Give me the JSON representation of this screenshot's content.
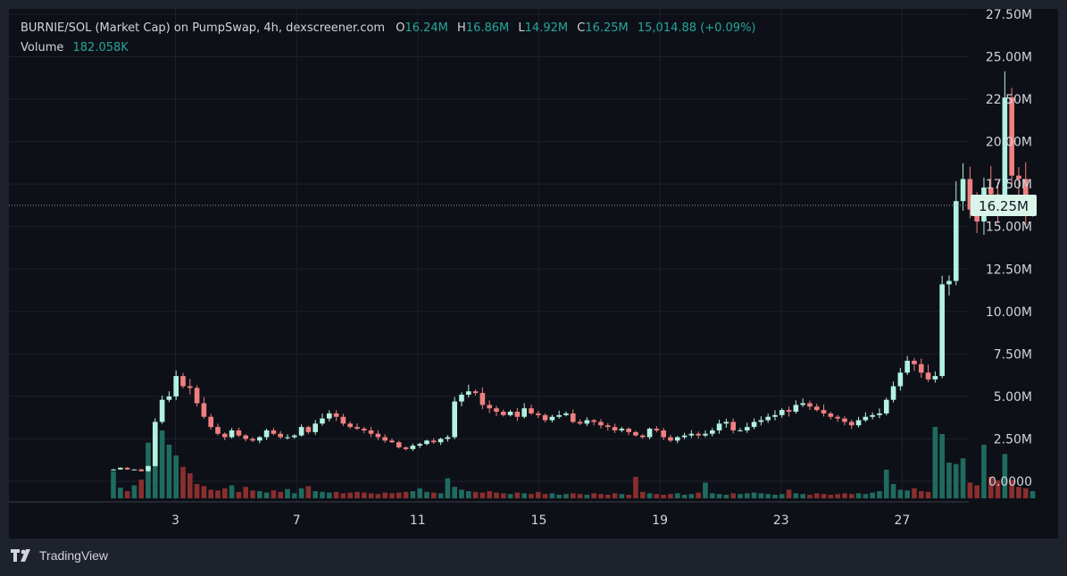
{
  "colors": {
    "bg": "#0e1017",
    "outer": "#1e222d",
    "grid": "#1c202b",
    "text": "#d1d4dc",
    "up": "#26a69a",
    "down": "#ef5350",
    "candle_up": "#b2f2e0",
    "candle_down": "#f08080",
    "vol_up": "#1f6b5f",
    "vol_down": "#8a2e2e",
    "price_label_bg": "#d9f5ea"
  },
  "legend": {
    "title": "BURNIE/SOL (Market Cap) on PumpSwap, 4h, dexscreener.com",
    "o_label": "O",
    "o_value": "16.24M",
    "h_label": "H",
    "h_value": "16.86M",
    "l_label": "L",
    "l_value": "14.92M",
    "c_label": "C",
    "c_value": "16.25M",
    "change": "15,014.88 (+0.09%)",
    "volume_label": "Volume",
    "volume_value": "182.058K"
  },
  "footer": {
    "brand": "TradingView"
  },
  "chart_data": {
    "type": "candlestick",
    "title": "BURNIE/SOL (Market Cap) on PumpSwap, 4h, dexscreener.com",
    "y_ticks": [
      "0.0000",
      "2.50M",
      "5.00M",
      "7.50M",
      "10.00M",
      "12.50M",
      "15.00M",
      "17.50M",
      "20.00M",
      "22.50M",
      "25.00M",
      "27.50M"
    ],
    "y_tick_values": [
      0,
      2.5,
      5,
      7.5,
      10,
      12.5,
      15,
      17.5,
      20,
      22.5,
      25,
      27.5
    ],
    "x_ticks": [
      "3",
      "7",
      "11",
      "15",
      "19",
      "23",
      "27"
    ],
    "x_tick_values": [
      3,
      7,
      11,
      15,
      19,
      23,
      27
    ],
    "ylim": [
      0,
      27.5
    ],
    "xlim": [
      -2.5,
      29.2
    ],
    "current_price": 16.25,
    "current_price_label": "16.25M",
    "price_unit": "M",
    "closes": [
      0.7,
      0.8,
      0.7,
      0.7,
      0.6,
      0.9,
      3.5,
      4.8,
      5.0,
      6.2,
      5.6,
      5.5,
      4.6,
      3.8,
      3.2,
      2.8,
      2.6,
      3.0,
      2.7,
      2.5,
      2.4,
      2.6,
      3.0,
      2.8,
      2.6,
      2.6,
      2.7,
      3.2,
      2.9,
      3.4,
      3.7,
      4.0,
      3.8,
      3.4,
      3.2,
      3.1,
      3.0,
      2.8,
      2.6,
      2.4,
      2.3,
      2.0,
      1.9,
      2.1,
      2.2,
      2.4,
      2.3,
      2.5,
      2.6,
      4.7,
      5.1,
      5.3,
      5.2,
      4.5,
      4.3,
      4.1,
      3.9,
      4.1,
      3.8,
      4.3,
      4.0,
      3.9,
      3.6,
      3.8,
      3.9,
      4.0,
      3.5,
      3.4,
      3.6,
      3.5,
      3.3,
      3.2,
      3.0,
      3.1,
      2.9,
      2.7,
      2.6,
      3.1,
      3.0,
      2.6,
      2.4,
      2.6,
      2.7,
      2.8,
      2.7,
      2.8,
      3.0,
      3.4,
      3.5,
      3.0,
      3.0,
      3.2,
      3.5,
      3.6,
      3.8,
      3.9,
      4.2,
      4.1,
      4.5,
      4.6,
      4.4,
      4.2,
      4.0,
      3.8,
      3.7,
      3.5,
      3.3,
      3.6,
      3.8,
      3.9,
      4.0,
      4.8,
      5.6,
      6.4,
      7.1,
      6.9,
      6.4,
      6.0,
      6.2,
      11.6,
      11.8,
      16.5,
      17.8,
      16.0,
      15.3,
      17.3,
      16.9,
      16.3,
      22.6,
      18.0,
      17.8,
      16.2,
      16.25
    ],
    "volumes_rel": [
      0.38,
      0.15,
      0.1,
      0.18,
      0.26,
      0.78,
      0.98,
      0.95,
      0.75,
      0.6,
      0.44,
      0.35,
      0.2,
      0.17,
      0.12,
      0.11,
      0.14,
      0.18,
      0.09,
      0.16,
      0.11,
      0.1,
      0.08,
      0.11,
      0.09,
      0.13,
      0.07,
      0.14,
      0.17,
      0.1,
      0.09,
      0.08,
      0.09,
      0.07,
      0.08,
      0.09,
      0.08,
      0.07,
      0.06,
      0.08,
      0.07,
      0.08,
      0.09,
      0.1,
      0.14,
      0.09,
      0.08,
      0.07,
      0.28,
      0.16,
      0.12,
      0.1,
      0.09,
      0.08,
      0.1,
      0.08,
      0.07,
      0.06,
      0.08,
      0.07,
      0.06,
      0.09,
      0.06,
      0.07,
      0.05,
      0.06,
      0.07,
      0.06,
      0.05,
      0.07,
      0.06,
      0.05,
      0.07,
      0.06,
      0.05,
      0.3,
      0.09,
      0.07,
      0.06,
      0.05,
      0.06,
      0.07,
      0.05,
      0.06,
      0.08,
      0.22,
      0.07,
      0.06,
      0.05,
      0.07,
      0.06,
      0.07,
      0.08,
      0.07,
      0.06,
      0.05,
      0.06,
      0.12,
      0.07,
      0.06,
      0.05,
      0.07,
      0.06,
      0.05,
      0.06,
      0.07,
      0.06,
      0.07,
      0.06,
      0.08,
      0.1,
      0.4,
      0.2,
      0.12,
      0.11,
      0.14,
      0.1,
      0.09,
      1.0,
      0.9,
      0.5,
      0.48,
      0.56,
      0.22,
      0.18,
      0.75,
      0.3,
      0.25,
      0.62,
      0.26,
      0.16,
      0.14,
      0.1
    ],
    "candle_start": 0.95,
    "candle_step": 0.23
  }
}
